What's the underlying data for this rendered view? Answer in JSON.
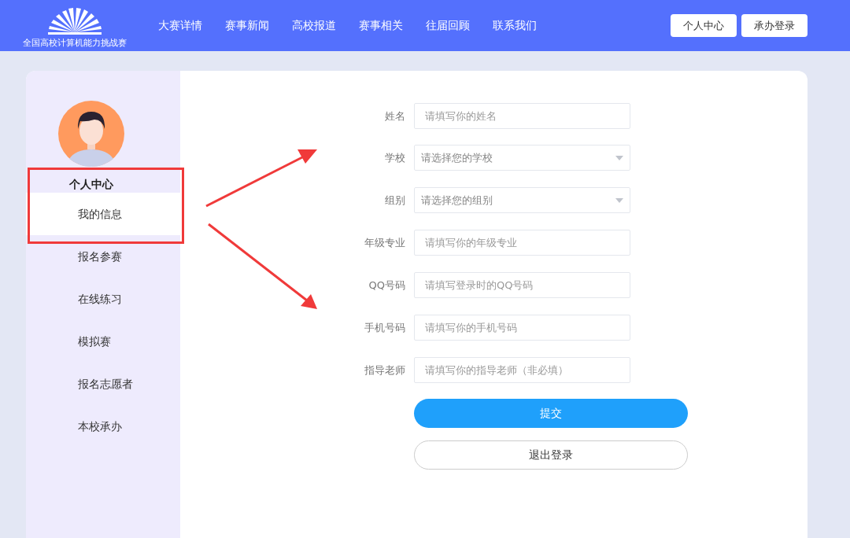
{
  "header": {
    "logo_text": "全国高校计算机能力挑战赛",
    "nav": [
      {
        "label": "大赛详情"
      },
      {
        "label": "赛事新闻"
      },
      {
        "label": "高校报道"
      },
      {
        "label": "赛事相关"
      },
      {
        "label": "往届回顾"
      },
      {
        "label": "联系我们"
      }
    ],
    "buttons": [
      "个人中心",
      "承办登录"
    ]
  },
  "sidebar": {
    "title": "个人中心",
    "items": [
      {
        "label": "我的信息",
        "selected": true
      },
      {
        "label": "报名参赛",
        "selected": false
      },
      {
        "label": "在线练习",
        "selected": false
      },
      {
        "label": "模拟赛",
        "selected": false
      },
      {
        "label": "报名志愿者",
        "selected": false
      },
      {
        "label": "本校承办",
        "selected": false
      }
    ]
  },
  "form": {
    "fields": [
      {
        "kind": "input",
        "label": "姓名",
        "placeholder": "请填写你的姓名"
      },
      {
        "kind": "select",
        "label": "学校",
        "placeholder": "请选择您的学校"
      },
      {
        "kind": "select",
        "label": "组别",
        "placeholder": "请选择您的组别"
      },
      {
        "kind": "input",
        "label": "年级专业",
        "placeholder": "请填写你的年级专业"
      },
      {
        "kind": "input",
        "label": "QQ号码",
        "placeholder": "请填写登录时的QQ号码"
      },
      {
        "kind": "input",
        "label": "手机号码",
        "placeholder": "请填写你的手机号码"
      },
      {
        "kind": "input",
        "label": "指导老师",
        "placeholder": "请填写你的指导老师（非必填）"
      }
    ],
    "submit": "提交",
    "logout": "退出登录"
  }
}
